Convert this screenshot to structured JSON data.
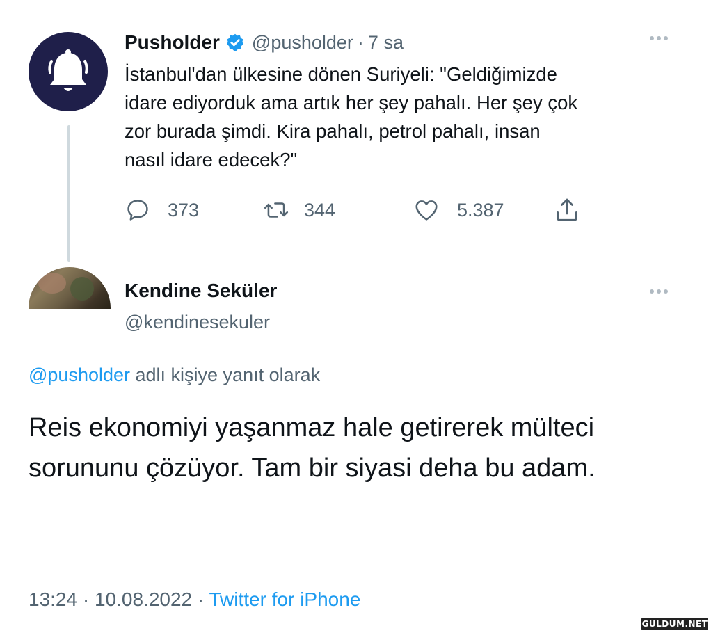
{
  "tweet": {
    "author_name": "Pusholder",
    "author_handle": "@pusholder",
    "separator": "·",
    "time_ago": "7 sa",
    "text": "İstanbul'dan ülkesine dönen Suriyeli: \"Geldiğimizde\nidare ediyorduk ama artık her şey pahalı. Her şey çok\nzor burada şimdi. Kira pahalı, petrol pahalı, insan\nnasıl idare edecek?\"",
    "replies": "373",
    "retweets": "344",
    "likes": "5.387",
    "avatar_icon": "bell-icon",
    "verified_color": "#1d9bf0"
  },
  "reply": {
    "author_name": "Kendine Seküler",
    "author_handle": "@kendinesekuler",
    "replying_to_handle": "@pusholder",
    "replying_to_suffix": " adlı kişiye yanıt olarak",
    "text": "Reis ekonomiyi yaşanmaz hale getirerek mülteci sorununu çözüyor. Tam bir siyasi deha bu adam.",
    "time": "13:24",
    "separator": "·",
    "date": "10.08.2022",
    "source": "Twitter for iPhone"
  },
  "watermark": "GULDUM.NET",
  "colors": {
    "link": "#1d9bf0",
    "secondary_text": "#536471",
    "avatar_bg": "#1f1f4a"
  }
}
